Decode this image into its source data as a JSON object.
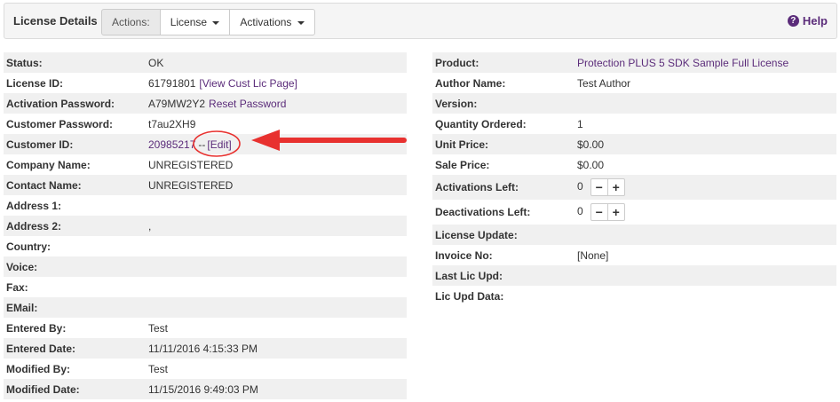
{
  "header": {
    "title": "License Details",
    "actions_label": "Actions:",
    "license_menu": "License",
    "activations_menu": "Activations",
    "help": "Help"
  },
  "left": [
    {
      "label": "Status:",
      "value": "OK"
    },
    {
      "label": "License ID:",
      "value": "61791801",
      "link": "[View Cust Lic Page]"
    },
    {
      "label": "Activation Password:",
      "value": "A79MW2Y2",
      "link": "Reset Password"
    },
    {
      "label": "Customer Password:",
      "value": "t7au2XH9"
    },
    {
      "label": "Customer ID:",
      "link_value": "20985217",
      "sep": "--",
      "link": "[Edit]"
    },
    {
      "label": "Company Name:",
      "value": "UNREGISTERED"
    },
    {
      "label": "Contact Name:",
      "value": "UNREGISTERED"
    },
    {
      "label": "Address 1:",
      "value": ""
    },
    {
      "label": "Address 2:",
      "value": ","
    },
    {
      "label": "Country:",
      "value": ""
    },
    {
      "label": "Voice:",
      "value": ""
    },
    {
      "label": "Fax:",
      "value": ""
    },
    {
      "label": "EMail:",
      "value": ""
    },
    {
      "label": "Entered By:",
      "value": "Test"
    },
    {
      "label": "Entered Date:",
      "value": "11/11/2016 4:15:33 PM"
    },
    {
      "label": "Modified By:",
      "value": "Test"
    },
    {
      "label": "Modified Date:",
      "value": "11/15/2016 9:49:03 PM"
    }
  ],
  "right": [
    {
      "label": "Product:",
      "link_value": "Protection PLUS 5 SDK Sample Full License"
    },
    {
      "label": "Author Name:",
      "value": "Test Author"
    },
    {
      "label": "Version:",
      "value": ""
    },
    {
      "label": "Quantity Ordered:",
      "value": "1"
    },
    {
      "label": "Unit Price:",
      "value": "$0.00"
    },
    {
      "label": "Sale Price:",
      "value": "$0.00"
    },
    {
      "label": "Activations Left:",
      "value": "0",
      "stepper": true
    },
    {
      "label": "Deactivations Left:",
      "value": "0",
      "stepper": true
    },
    {
      "label": "License Update:",
      "value": ""
    },
    {
      "label": "Invoice No:",
      "value": "[None]"
    },
    {
      "label": "Last Lic Upd:",
      "value": ""
    },
    {
      "label": "Lic Upd Data:",
      "value": ""
    }
  ],
  "stepper": {
    "minus": "−",
    "plus": "+"
  },
  "colors": {
    "link": "#5b2c7a",
    "annotation": "#e8312f",
    "row_alt": "#f0f0f0"
  }
}
